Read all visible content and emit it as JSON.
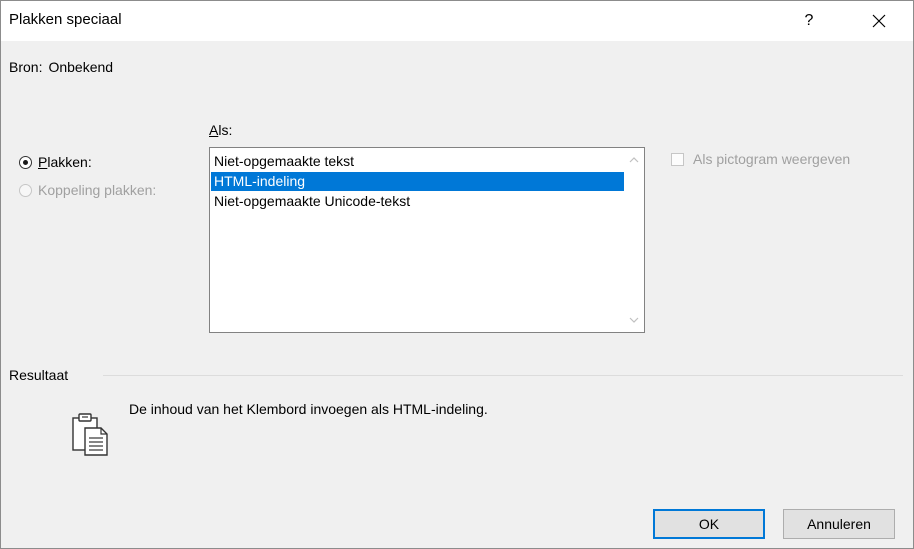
{
  "window": {
    "title": "Plakken speciaal",
    "help_label": "?"
  },
  "source": {
    "label": "Bron:",
    "value": "Onbekend"
  },
  "options": {
    "paste_accel": "P",
    "paste_rest": "lakken:",
    "paste_checked": true,
    "link_label": "Koppeling plakken:",
    "link_enabled": false
  },
  "as": {
    "accel": "A",
    "rest": "ls:",
    "items": [
      {
        "label": "Niet-opgemaakte tekst",
        "selected": false
      },
      {
        "label": "HTML-indeling",
        "selected": true
      },
      {
        "label": "Niet-opgemaakte Unicode-tekst",
        "selected": false
      }
    ]
  },
  "icon_option": {
    "label": "Als pictogram weergeven",
    "checked": false,
    "enabled": false
  },
  "result": {
    "label": "Resultaat",
    "text": "De inhoud van het Klembord invoegen als HTML-indeling.",
    "icon": "clipboard-paste-icon"
  },
  "buttons": {
    "ok": "OK",
    "cancel": "Annuleren"
  },
  "colors": {
    "selection": "#0078d7",
    "dialog_bg": "#f0f0f0",
    "disabled_text": "#a0a0a0"
  }
}
